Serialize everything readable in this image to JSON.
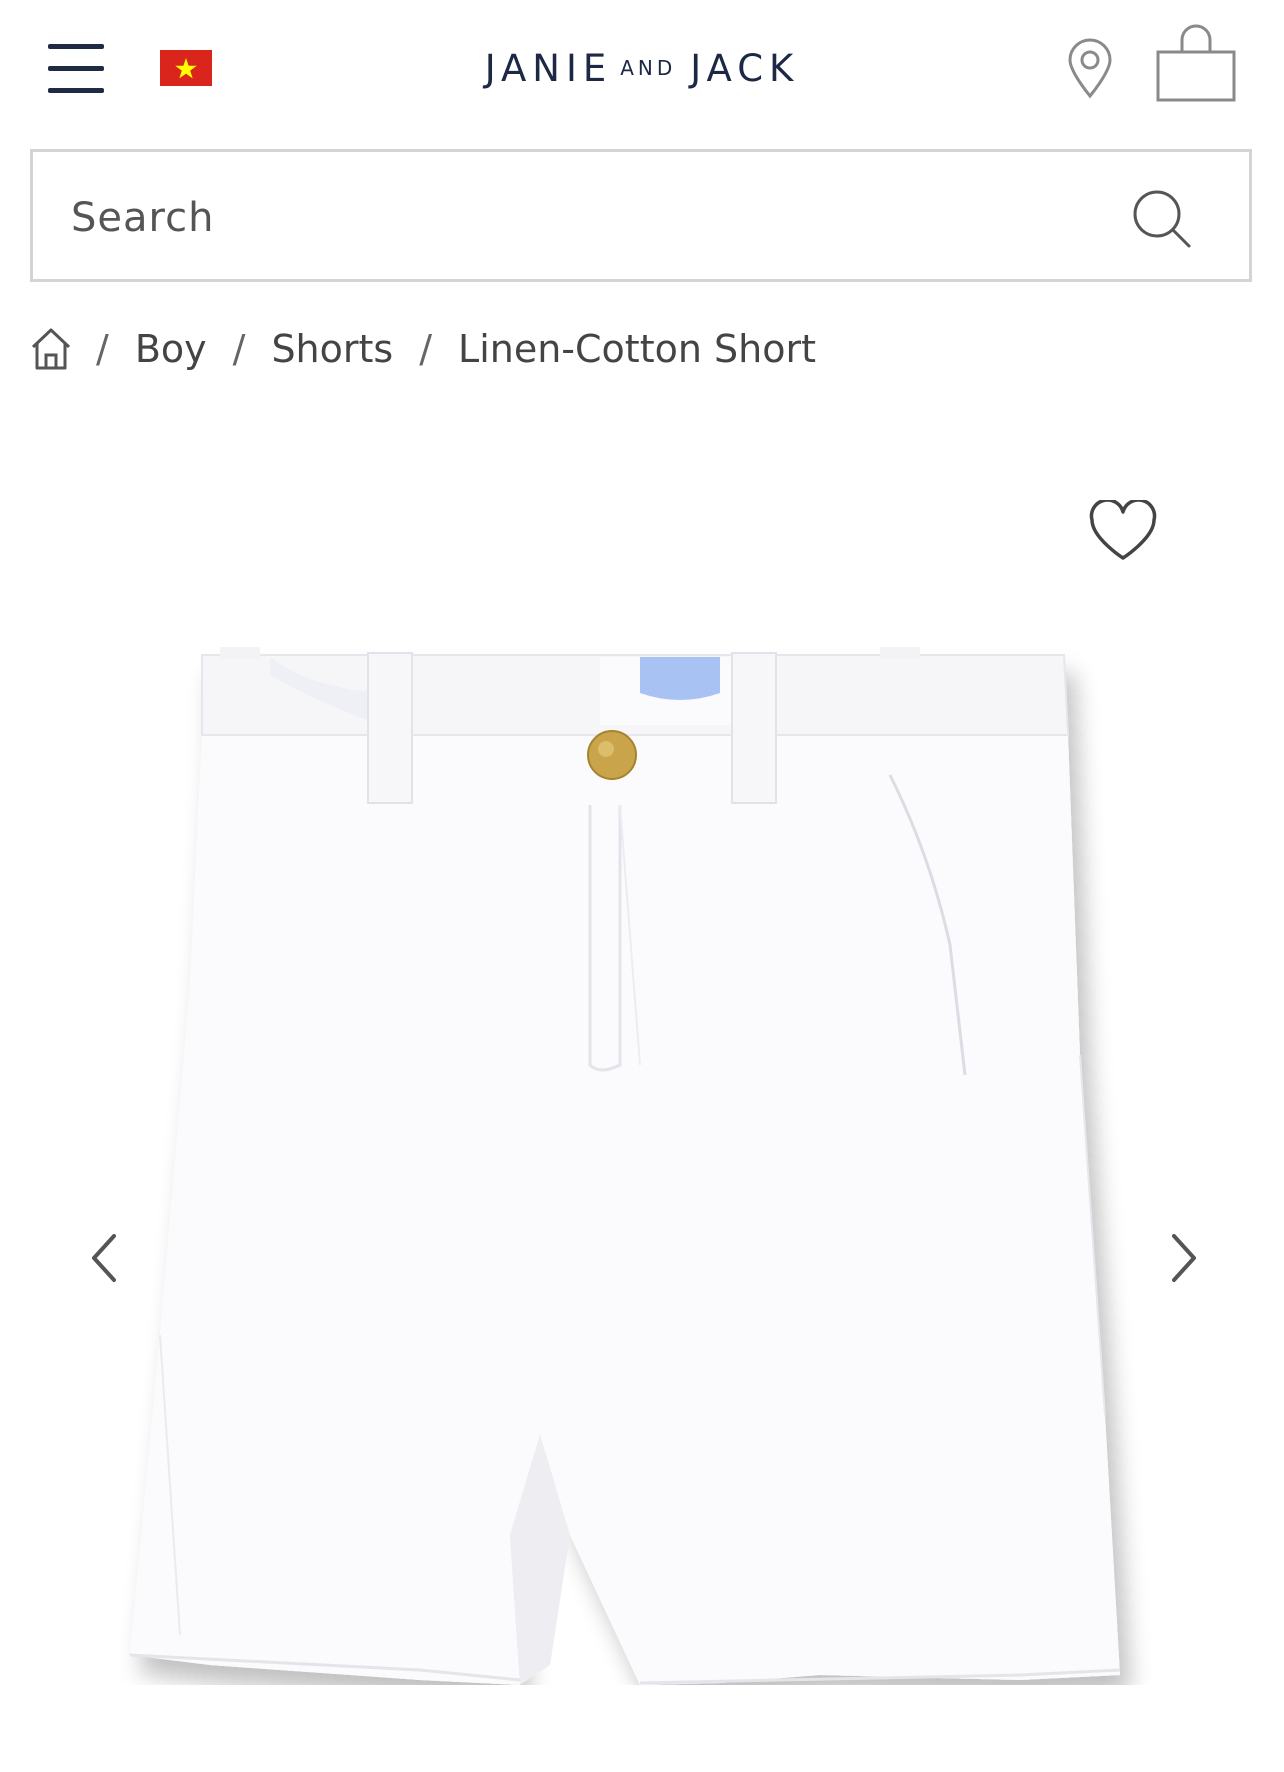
{
  "header": {
    "logo_left": "JANIE",
    "logo_mid": "AND",
    "logo_right": "JACK",
    "brand_color": "#1c2845"
  },
  "search": {
    "placeholder": "Search"
  },
  "breadcrumb": {
    "items": [
      "Boy",
      "Shorts",
      "Linen-Cotton Short"
    ],
    "separator": "/"
  },
  "icons": {
    "menu": "hamburger-icon",
    "flag": "vietnam-flag-icon",
    "location": "location-pin-icon",
    "bag": "shopping-bag-icon",
    "search": "search-icon",
    "home": "home-icon",
    "favorite": "heart-icon",
    "prev": "chevron-left-icon",
    "next": "chevron-right-icon"
  }
}
